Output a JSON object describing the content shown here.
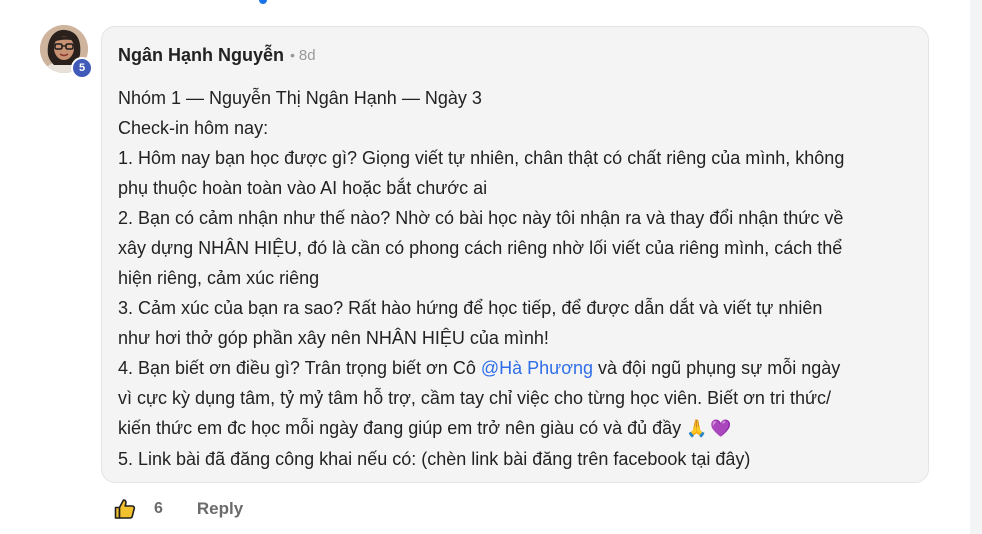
{
  "comment": {
    "author": "Ngân Hạnh Nguyễn",
    "separator": "•",
    "time": "8d",
    "level": "5",
    "lines": [
      "Nhóm 1 — Nguyễn Thị Ngân Hạnh — Ngày 3",
      "Check-in hôm nay:",
      "1. Hôm nay bạn học được gì? Giọng viết tự nhiên, chân thật có chất riêng của mình, không",
      "phụ thuộc hoàn toàn vào AI hoặc bắt chước ai",
      "2. Bạn có cảm nhận như thế nào? Nhờ có bài học này tôi nhận ra và thay đổi nhận thức về",
      "xây dựng NHÂN HIỆU, đó là cần có phong cách riêng nhờ lối viết của riêng mình, cách thể",
      "hiện riêng, cảm xúc riêng",
      "3. Cảm xúc của bạn ra sao? Rất hào hứng để học tiếp, để được dẫn dắt và viết tự nhiên",
      "như hơi thở góp phần xây nên NHÂN HIỆU của mình!"
    ],
    "line_10_before": "4. Bạn biết ơn điều gì? Trân trọng biết ơn Cô ",
    "mention": "@Hà Phương",
    "line_10_after": " và đội ngũ phụng sự mỗi ngày",
    "line_11": "vì cực kỳ dụng tâm, tỷ mỷ tâm hỗ trợ, cầm tay chỉ việc cho từng học viên. Biết ơn tri thức/",
    "line_12": "kiến thức em đc học mỗi ngày đang giúp em trở nên giàu có và đủ đầy",
    "emoji_pray": "🙏",
    "emoji_heart": "💜",
    "line_13": "5. Link bài đã đăng công khai nếu có: (chèn link bài đăng trên facebook tại đây)"
  },
  "actions": {
    "like_icon": "thumbs-up-icon",
    "like_count": "6",
    "reply_label": "Reply"
  },
  "colors": {
    "mention": "#2f6ee8",
    "level_badge": "#3f5ab8",
    "bubble_bg": "#f4f4f4"
  }
}
